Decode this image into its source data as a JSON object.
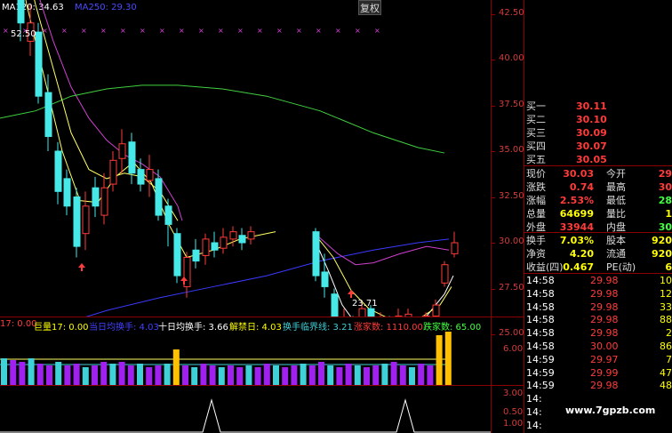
{
  "header": {
    "ma120_label": "MA120: 34.63",
    "ma250_label": "MA250: 29.30",
    "restore_button": "复权"
  },
  "price_axis": [
    "42.50",
    "40.00",
    "37.50",
    "35.00",
    "32.50",
    "30.00",
    "27.50",
    "25.00"
  ],
  "annotations": {
    "high": "52.50",
    "low": "23.71"
  },
  "indicator_legend": [
    {
      "text": "17: 0.00",
      "color": "#ff3b3b"
    },
    {
      "text": "巨量17: 0.00",
      "color": "#ffff00"
    },
    {
      "text": "当日均换手: 4.03",
      "color": "#4040ff"
    },
    {
      "text": "十日均换手: 3.66",
      "color": "#ffffff"
    },
    {
      "text": "解禁日: 4.03",
      "color": "#ffff00"
    },
    {
      "text": "换手临界线: 3.21",
      "color": "#3fd1d8"
    },
    {
      "text": "涨家数: 1110.00",
      "color": "#ff3b3b"
    },
    {
      "text": "跌家数: 65.00",
      "color": "#40ff40"
    }
  ],
  "volume_axis": [
    "6.00",
    "3.00"
  ],
  "signal_axis": [
    "1.00",
    "0.50"
  ],
  "order_book": [
    {
      "label": "买一",
      "value": "30.11"
    },
    {
      "label": "买二",
      "value": "30.10"
    },
    {
      "label": "买三",
      "value": "30.09"
    },
    {
      "label": "买四",
      "value": "30.07"
    },
    {
      "label": "买五",
      "value": "30.05"
    }
  ],
  "quote": [
    {
      "l1": "现价",
      "v1": "30.03",
      "c1": "#ff3b3b",
      "l2": "今开",
      "v2": "29",
      "c2": "#ff3b3b"
    },
    {
      "l1": "涨跌",
      "v1": "0.74",
      "c1": "#ff3b3b",
      "l2": "最高",
      "v2": "30",
      "c2": "#ff3b3b"
    },
    {
      "l1": "涨幅",
      "v1": "2.53%",
      "c1": "#ff3b3b",
      "l2": "最低",
      "v2": "28",
      "c2": "#40ff40"
    },
    {
      "l1": "总量",
      "v1": "64699",
      "c1": "#ffff00",
      "l2": "量比",
      "v2": "1",
      "c2": "#ffff00"
    },
    {
      "l1": "外盘",
      "v1": "33944",
      "c1": "#ff3b3b",
      "l2": "内盘",
      "v2": "30",
      "c2": "#40ff40"
    },
    {
      "l1": "换手",
      "v1": "7.03%",
      "c1": "#ffff00",
      "l2": "股本",
      "v2": "920",
      "c2": "#ffff00"
    },
    {
      "l1": "净资",
      "v1": "4.20",
      "c1": "#ffff00",
      "l2": "流通",
      "v2": "920",
      "c2": "#ffff00"
    },
    {
      "l1": "收益(四)",
      "v1": "0.467",
      "c1": "#ffff00",
      "l2": "PE(动)",
      "v2": "6",
      "c2": "#ffff00"
    }
  ],
  "ticks": [
    {
      "time": "14:58",
      "price": "29.98",
      "pcolor": "#ff3b3b",
      "vol": "10",
      "vcolor": "#ffff00"
    },
    {
      "time": "14:58",
      "price": "29.98",
      "pcolor": "#ff3b3b",
      "vol": "12",
      "vcolor": "#ffff00"
    },
    {
      "time": "14:58",
      "price": "29.98",
      "pcolor": "#ff3b3b",
      "vol": "33",
      "vcolor": "#ffff00"
    },
    {
      "time": "14:58",
      "price": "29.98",
      "pcolor": "#ff3b3b",
      "vol": "88",
      "vcolor": "#ffff00"
    },
    {
      "time": "14:58",
      "price": "29.98",
      "pcolor": "#ff3b3b",
      "vol": "2",
      "vcolor": "#ffff00"
    },
    {
      "time": "14:58",
      "price": "30.00",
      "pcolor": "#ff3b3b",
      "vol": "86",
      "vcolor": "#ffff00"
    },
    {
      "time": "14:59",
      "price": "29.97",
      "pcolor": "#ff3b3b",
      "vol": "7",
      "vcolor": "#ffff00"
    },
    {
      "time": "14:59",
      "price": "29.99",
      "pcolor": "#ff3b3b",
      "vol": "47",
      "vcolor": "#ffff00"
    },
    {
      "time": "14:59",
      "price": "29.98",
      "pcolor": "#ff3b3b",
      "vol": "48",
      "vcolor": "#ffff00"
    },
    {
      "time": "14:",
      "price": "",
      "pcolor": "#ff3b3b",
      "vol": "",
      "vcolor": "#ffff00"
    },
    {
      "time": "14:",
      "price": "",
      "pcolor": "#ff3b3b",
      "vol": "",
      "vcolor": "#ffff00"
    },
    {
      "time": "14:",
      "price": "",
      "pcolor": "#ff3b3b",
      "vol": "",
      "vcolor": "#ffff00"
    }
  ],
  "watermark": "www.7gpzb.com",
  "colors": {
    "up": "#ff3b3b",
    "down": "#46e8e8",
    "ma5": "#ffffff",
    "ma10": "#ffff66",
    "ma20": "#d040d0",
    "ma60": "#40d040",
    "ma120": "#3a3aff",
    "vol_purple": "#a020f0",
    "vol_cyan": "#3fd1d8",
    "vol_yellow": "#ffc000",
    "grid": "#8b0000"
  }
}
